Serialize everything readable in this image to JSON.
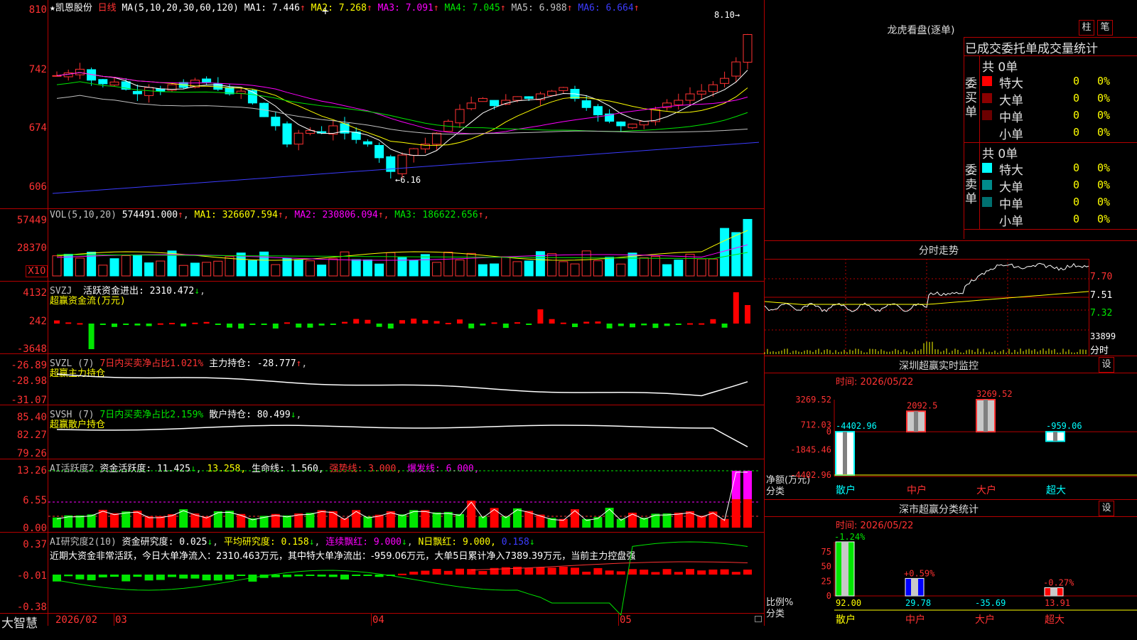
{
  "stock": {
    "star": "★",
    "name": "凯恩股份",
    "period": "日线"
  },
  "main": {
    "ma_header": "MA(5,10,20,30,60,120)",
    "ma": [
      {
        "label": "MA1:",
        "value": "7.446",
        "color": "#ffffff"
      },
      {
        "label": "MA2:",
        "value": "7.268",
        "color": "#ffff00"
      },
      {
        "label": "MA3:",
        "value": "7.091",
        "color": "#ff00ff"
      },
      {
        "label": "MA4:",
        "value": "7.045",
        "color": "#00e600"
      },
      {
        "label": "MA5:",
        "value": "6.988",
        "color": "#c0c0c0"
      },
      {
        "label": "MA6:",
        "value": "6.664",
        "color": "#3c3cff"
      }
    ],
    "arrow": "↑",
    "axis": [
      "810",
      "742",
      "674",
      "606"
    ],
    "high_label": "8.10",
    "low_label": "6.16",
    "cross": "+"
  },
  "vol": {
    "header": "VOL(5,10,20)",
    "value": "574491.000",
    "ma": [
      {
        "label": "MA1:",
        "value": "326607.594",
        "color": "#ffff00"
      },
      {
        "label": "MA2:",
        "value": "230806.094",
        "color": "#ff00ff"
      },
      {
        "label": "MA3:",
        "value": "186622.656",
        "color": "#00e600"
      }
    ],
    "axis": [
      "57449",
      "28370"
    ],
    "unit": "X10"
  },
  "svzj": {
    "header": "SVZJ",
    "label": "活跃资金进出:",
    "value": "2310.472",
    "arrow": "↓",
    "sub": "超赢资金流(万元)",
    "axis": [
      "4132",
      "242",
      "-3648"
    ]
  },
  "svzl": {
    "header": "SVZL (7)",
    "part1": "7日内买卖净占比1.021%",
    "label": "主力持仓:",
    "value": "-28.777",
    "arrow": "↑",
    "sub": "超赢主力持仓",
    "axis": [
      "-26.89",
      "-28.98",
      "-31.07"
    ]
  },
  "svsh": {
    "header": "SVSH (7)",
    "part1": "7日内买卖净占比2.159%",
    "label": "散户持仓:",
    "value": "80.499",
    "arrow": "↓",
    "sub": "超赢散户持仓",
    "axis": [
      "85.40",
      "82.27",
      "79.26"
    ]
  },
  "ai1": {
    "header": "AI活跃度2",
    "label": "资金活跃度:",
    "value": "11.425",
    "arrow": "↓",
    "v2": "13.258,",
    "life": "生命线: 1.560,",
    "strong": "强势线: 3.000,",
    "burst": "爆发线: 6.000,",
    "axis": [
      "13.26",
      "6.55",
      "0.00"
    ]
  },
  "ai2": {
    "header": "AI研究度2(10)",
    "label": "资金研究度:",
    "value": "0.025",
    "avg": "平均研究度: 0.158",
    "cont": "连续飘红: 9.000",
    "nday": "N日飘红: 9.000,",
    "nval": "0.158",
    "comment": "近期大资金非常活跃，今日大单净流入：2310.463万元，其中特大单净流出：-959.06万元，大单5日累计净入7389.39万元，当前主力控盘强",
    "axis": [
      "0.37",
      "-0.01",
      "-0.38"
    ]
  },
  "bottom": {
    "brand": "大智慧",
    "dates": [
      "2026/02",
      "03",
      "04",
      "05"
    ]
  },
  "lhb": {
    "title": "龙虎看盘(逐单)",
    "btn1": "柱",
    "btn2": "笔",
    "stats_title": "已成交委托单成交量统计",
    "buy_side": "委买单",
    "sell_side": "委卖单",
    "buy_total": "共 0单",
    "sell_total": "共 0单",
    "buy_rows": [
      {
        "name": "特大",
        "count": "0",
        "pct": "0%",
        "color": "#ff0000"
      },
      {
        "name": "大单",
        "count": "0",
        "pct": "0%",
        "color": "#8b0000"
      },
      {
        "name": "中单",
        "count": "0",
        "pct": "0%",
        "color": "#6b0000"
      },
      {
        "name": "小单",
        "count": "0",
        "pct": "0%",
        "color": "#000000"
      }
    ],
    "sell_rows": [
      {
        "name": "特大",
        "count": "0",
        "pct": "0%",
        "color": "#00ffff"
      },
      {
        "name": "大单",
        "count": "0",
        "pct": "0%",
        "color": "#008b8b"
      },
      {
        "name": "中单",
        "count": "0",
        "pct": "0%",
        "color": "#007070"
      },
      {
        "name": "小单",
        "count": "0",
        "pct": "0%",
        "color": "#000000"
      }
    ]
  },
  "intraday": {
    "title": "分时走势",
    "axis": [
      "7.70",
      "7.51",
      "7.32"
    ],
    "vol_label": "33899",
    "corner": "分时"
  },
  "monitor": {
    "title": "深圳超赢实时监控",
    "btn": "设",
    "time": "时间: 2026/05/22",
    "axis": [
      "3269.52",
      "712.03",
      "0",
      "-1845.46",
      "-4402.96"
    ],
    "ylabel1": "净额(万元)",
    "ylabel2": "分类",
    "categories": [
      "散户",
      "中户",
      "大户",
      "超大"
    ],
    "values": [
      -4402.96,
      2092.5,
      3269.52,
      -959.06
    ],
    "value_labels": [
      "-4402.96",
      "2092.5",
      "3269.52",
      "-959.06"
    ]
  },
  "classify": {
    "title": "深市超赢分类统计",
    "btn": "设",
    "time": "时间: 2026/05/22",
    "axis": [
      "75",
      "50",
      "25",
      "0"
    ],
    "ylabel1": "比例%",
    "ylabel2": "分类",
    "categories": [
      "散户",
      "中户",
      "大户",
      "超大"
    ],
    "values": [
      92.0,
      29.78,
      -35.69,
      13.91
    ],
    "value_labels": [
      "92.00",
      "29.78",
      "-35.69",
      "13.91"
    ],
    "change_labels": [
      "-1.24%",
      "+0.59%",
      "",
      "-0.27%"
    ]
  }
}
